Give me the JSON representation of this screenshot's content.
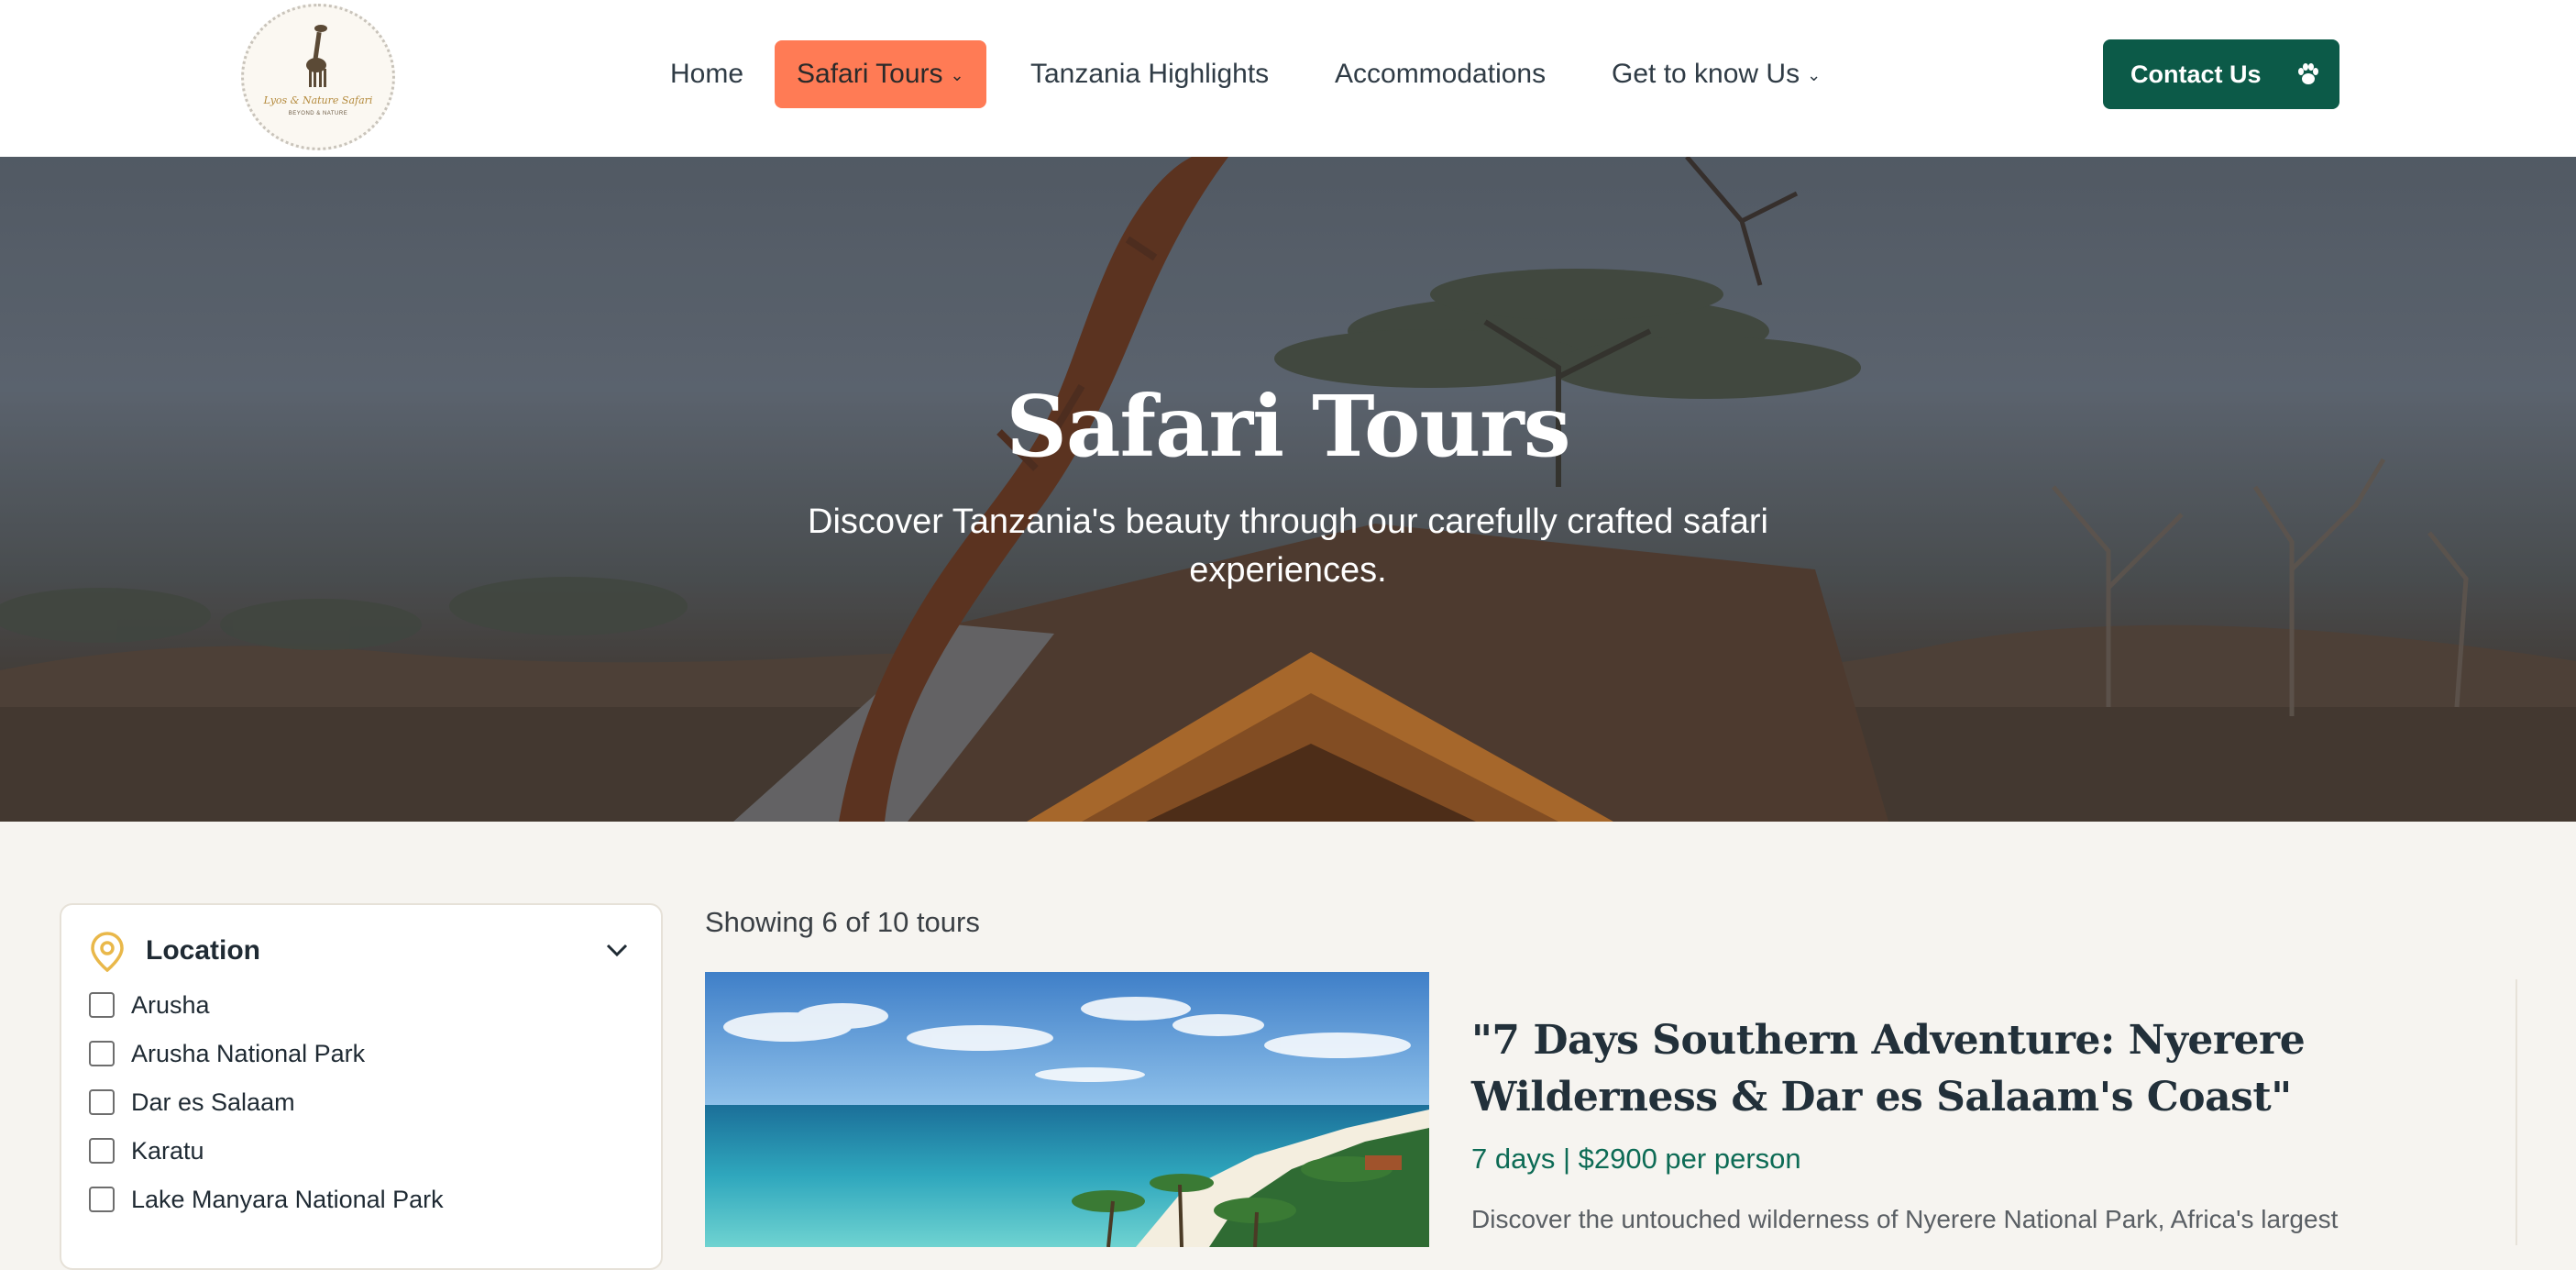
{
  "header": {
    "logo": {
      "name": "Lyos & Nature Safari",
      "tagline": "BEYOND & NATURE",
      "icon": "giraffe-icon"
    },
    "nav": [
      {
        "label": "Home",
        "active": false,
        "dropdown": false
      },
      {
        "label": "Safari Tours",
        "active": true,
        "dropdown": true
      },
      {
        "label": "Tanzania Highlights",
        "active": false,
        "dropdown": false
      },
      {
        "label": "Accommodations",
        "active": false,
        "dropdown": false
      },
      {
        "label": "Get to know Us",
        "active": false,
        "dropdown": true
      }
    ],
    "contact_button": {
      "label": "Contact Us",
      "icon": "paw-icon"
    }
  },
  "hero": {
    "title": "Safari Tours",
    "subtitle": "Discover Tanzania's beauty through our carefully crafted safari experiences."
  },
  "filters": {
    "location": {
      "title": "Location",
      "icon": "map-pin-icon",
      "expanded": true,
      "options": [
        {
          "label": "Arusha",
          "checked": false
        },
        {
          "label": "Arusha National Park",
          "checked": false
        },
        {
          "label": "Dar es Salaam",
          "checked": false
        },
        {
          "label": "Karatu",
          "checked": false
        },
        {
          "label": "Lake Manyara National Park",
          "checked": false
        }
      ]
    }
  },
  "results": {
    "summary": "Showing 6 of 10 tours",
    "tours": [
      {
        "title": "\"7 Days Southern Adventure: Nyerere Wilderness & Dar es Salaam's Coast\"",
        "meta": "7 days | $2900 per person",
        "description": "Discover the untouched wilderness of Nyerere National Park, Africa's largest"
      }
    ]
  },
  "colors": {
    "accent": "#ff7b55",
    "brand_green": "#0c5a48",
    "meta_green": "#0d6b55",
    "page_bg": "#f6f4f0",
    "pin_yellow": "#e9b84a"
  }
}
